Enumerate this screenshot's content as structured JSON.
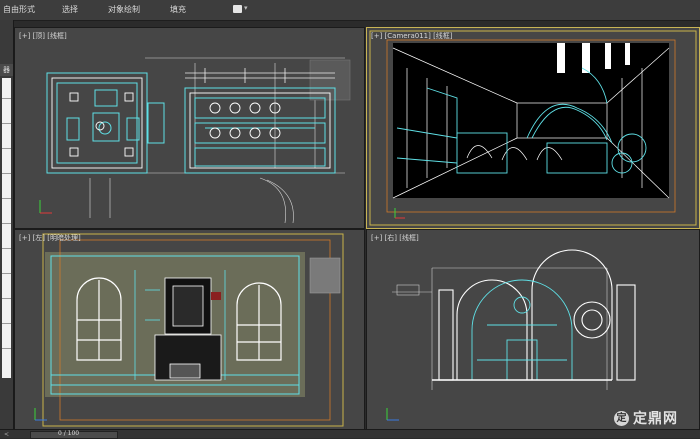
{
  "ribbon": {
    "items": [
      "自由形式",
      "选择",
      "对象绘制",
      "填充"
    ],
    "swatch_color": "#e6e6e6",
    "caret": "▾"
  },
  "left_panel": {
    "label": "器件"
  },
  "viewports": {
    "top": {
      "label": "[+] [顶] [线框]"
    },
    "camera": {
      "label": "[+] [Camera011] [线框]",
      "active": true
    },
    "left": {
      "label": "[+] [左] [明暗处理]"
    },
    "right": {
      "label": "[+] [右] [线框]"
    }
  },
  "statusbar": {
    "frame": "0 / 100"
  },
  "watermark": {
    "logo_char": "定",
    "text": "定鼎网"
  },
  "colors": {
    "wireframe_cyan": "#5fe0e6",
    "wireframe_white": "#ffffff",
    "safe_frame_yellow": "#c9b449",
    "safe_frame_orange": "#d07a2a",
    "viewport_bg": "#464646",
    "active_border": "#c8b454",
    "shaded_fill": "#6b6d59"
  }
}
